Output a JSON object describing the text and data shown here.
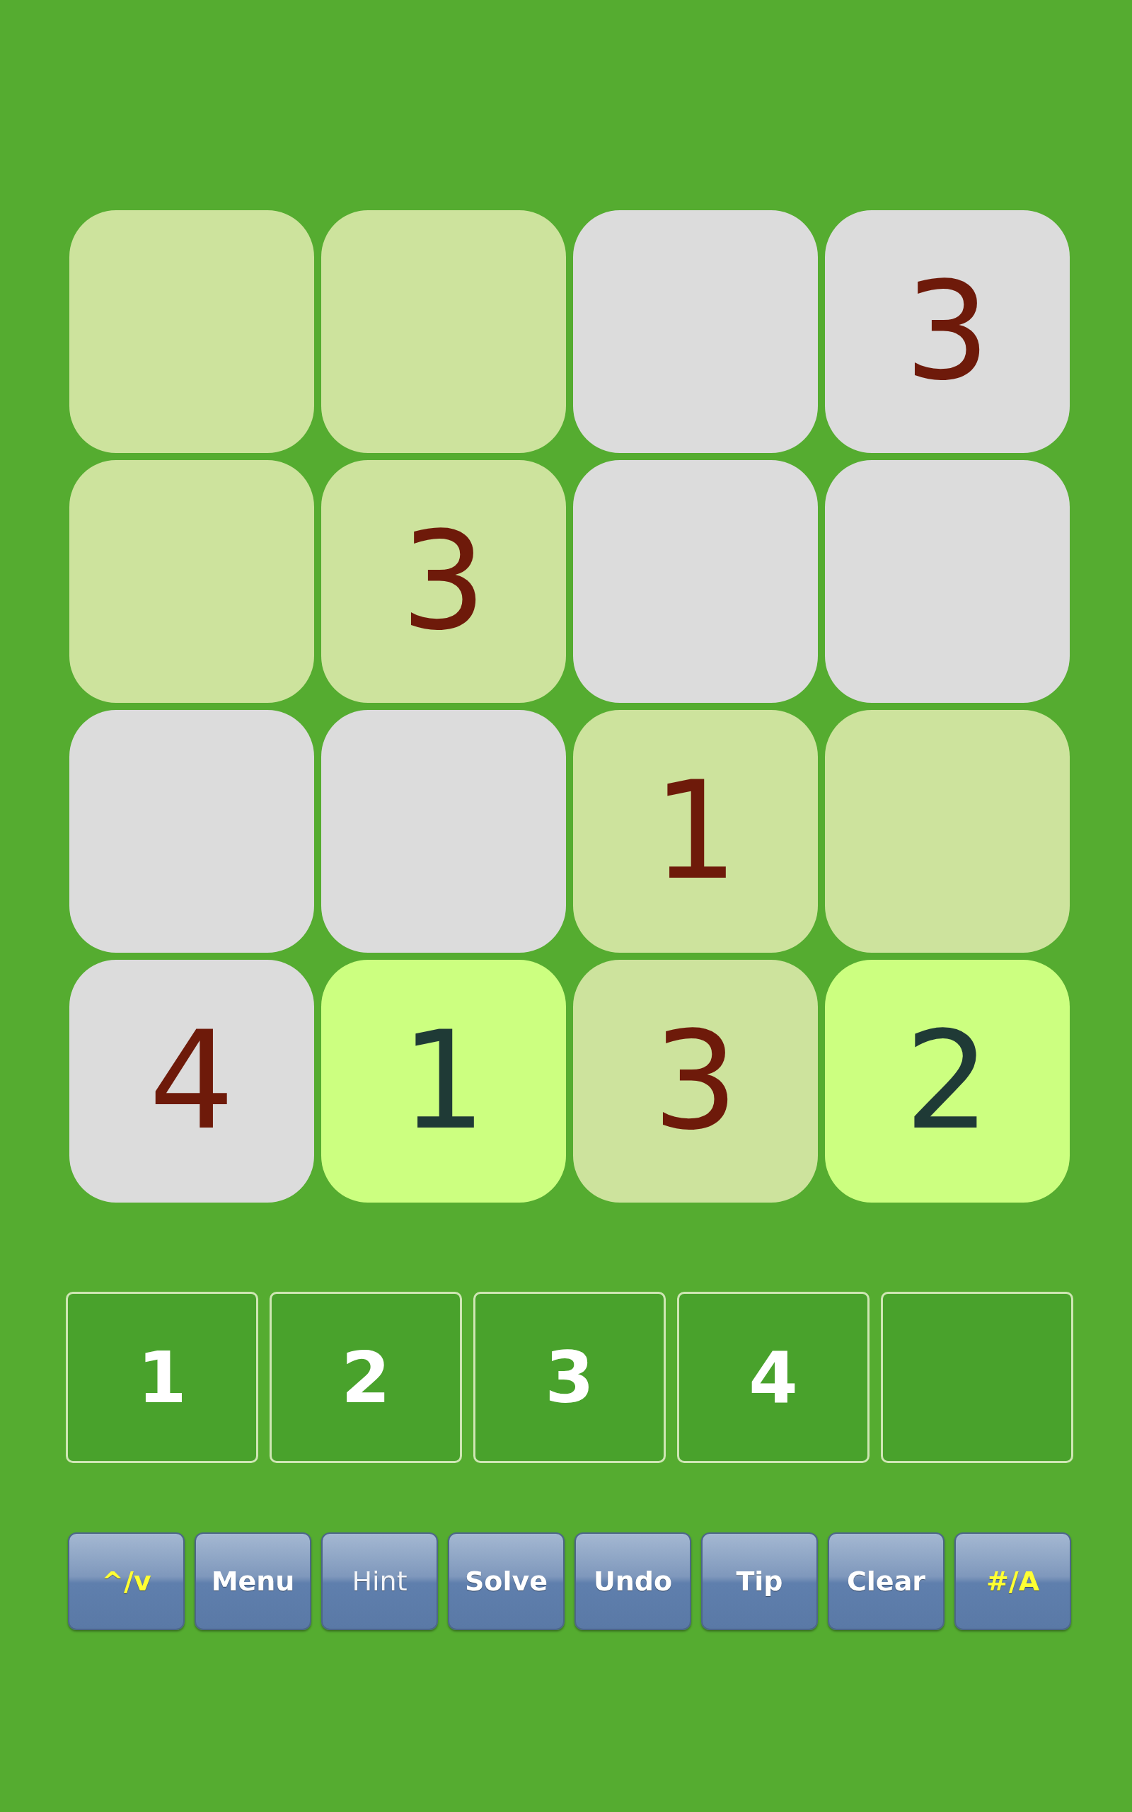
{
  "grid": {
    "rows": [
      [
        {
          "kind": "empty"
        },
        {
          "kind": "empty"
        },
        {
          "kind": "empty"
        },
        {
          "kind": "given",
          "value": "3"
        }
      ],
      [
        {
          "kind": "empty"
        },
        {
          "kind": "given",
          "value": "3"
        },
        {
          "kind": "empty"
        },
        {
          "kind": "empty"
        }
      ],
      [
        {
          "kind": "empty"
        },
        {
          "kind": "empty"
        },
        {
          "kind": "given",
          "value": "1"
        },
        {
          "kind": "empty"
        }
      ],
      [
        {
          "kind": "given",
          "value": "4"
        },
        {
          "kind": "entered",
          "value": "1"
        },
        {
          "kind": "given",
          "value": "3"
        },
        {
          "kind": "entered",
          "value": "2"
        }
      ]
    ]
  },
  "keypad": {
    "keys": [
      {
        "kind": "digit",
        "label": "1"
      },
      {
        "kind": "digit",
        "label": "2"
      },
      {
        "kind": "digit",
        "label": "3"
      },
      {
        "kind": "digit",
        "label": "4"
      },
      {
        "kind": "blank"
      }
    ]
  },
  "toolbar": {
    "buttons": [
      {
        "kind": "mode",
        "label": "^/v"
      },
      {
        "kind": "action",
        "label": "Menu"
      },
      {
        "kind": "plain",
        "label": "Hint"
      },
      {
        "kind": "action",
        "label": "Solve"
      },
      {
        "kind": "action",
        "label": "Undo"
      },
      {
        "kind": "action",
        "label": "Tip"
      },
      {
        "kind": "action",
        "label": "Clear"
      },
      {
        "kind": "mode",
        "label": "#/A"
      }
    ]
  }
}
